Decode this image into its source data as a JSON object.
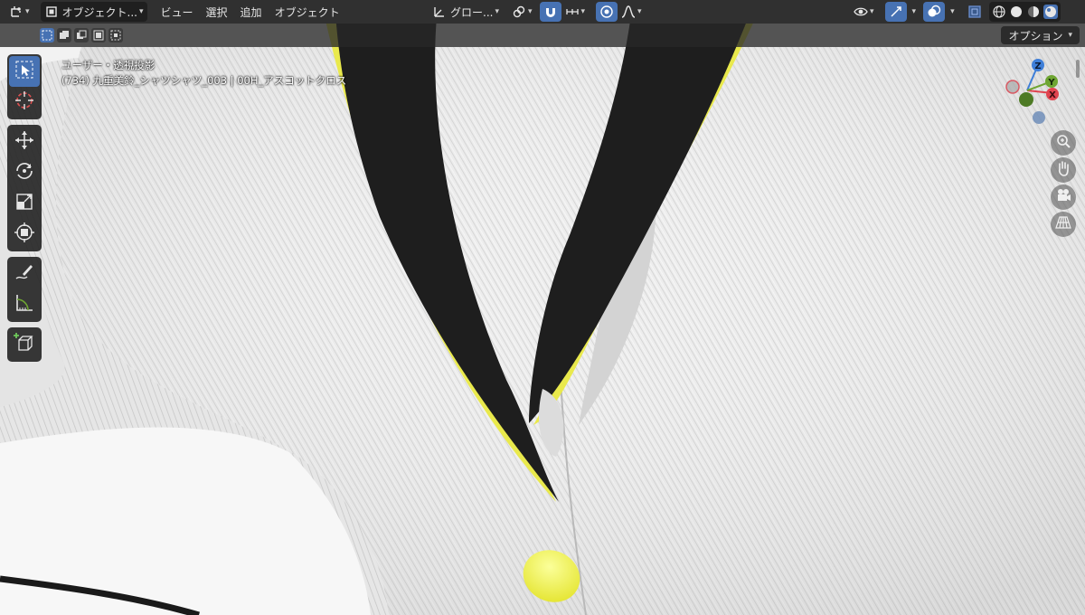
{
  "header": {
    "editor_type_icon": "3d-viewport-icon",
    "mode_label": "オブジェクト...",
    "menus": [
      "ビュー",
      "選択",
      "追加",
      "オブジェクト"
    ],
    "transform_orientation": "グロー...",
    "icons": [
      "transform-pivot-icon",
      "link-icon",
      "snap-magnet-icon",
      "snap-increment-icon",
      "proportional-edit-icon",
      "falloff-curve-icon",
      "visibility-icon",
      "gizmo-icon",
      "overlay-icon",
      "xray-icon",
      "wireframe-shading-icon",
      "solid-shading-icon",
      "material-preview-icon",
      "rendered-shading-icon"
    ]
  },
  "tool_settings": {
    "select_modes": [
      "select-box-new-icon",
      "select-box-extend-icon",
      "select-box-subtract-icon",
      "select-box-invert-icon",
      "select-box-intersect-icon"
    ],
    "options_label": "オプション"
  },
  "viewport_info": {
    "view_name": "ユーザー・透視投影",
    "object_info": "(734) 九重美鈴_シャツシャツ_003 | 00H_アスコットクロス"
  },
  "gizmo": {
    "x_label": "X",
    "y_label": "Y",
    "z_label": "Z"
  },
  "colors": {
    "accent": "#4772b3",
    "header_bg": "#303030",
    "x_axis": "#e0434f",
    "y_axis": "#6ea532",
    "z_axis": "#3f7fd8",
    "collar_black": "#1e1e1e",
    "piping_yellow": "#e6e64a"
  }
}
